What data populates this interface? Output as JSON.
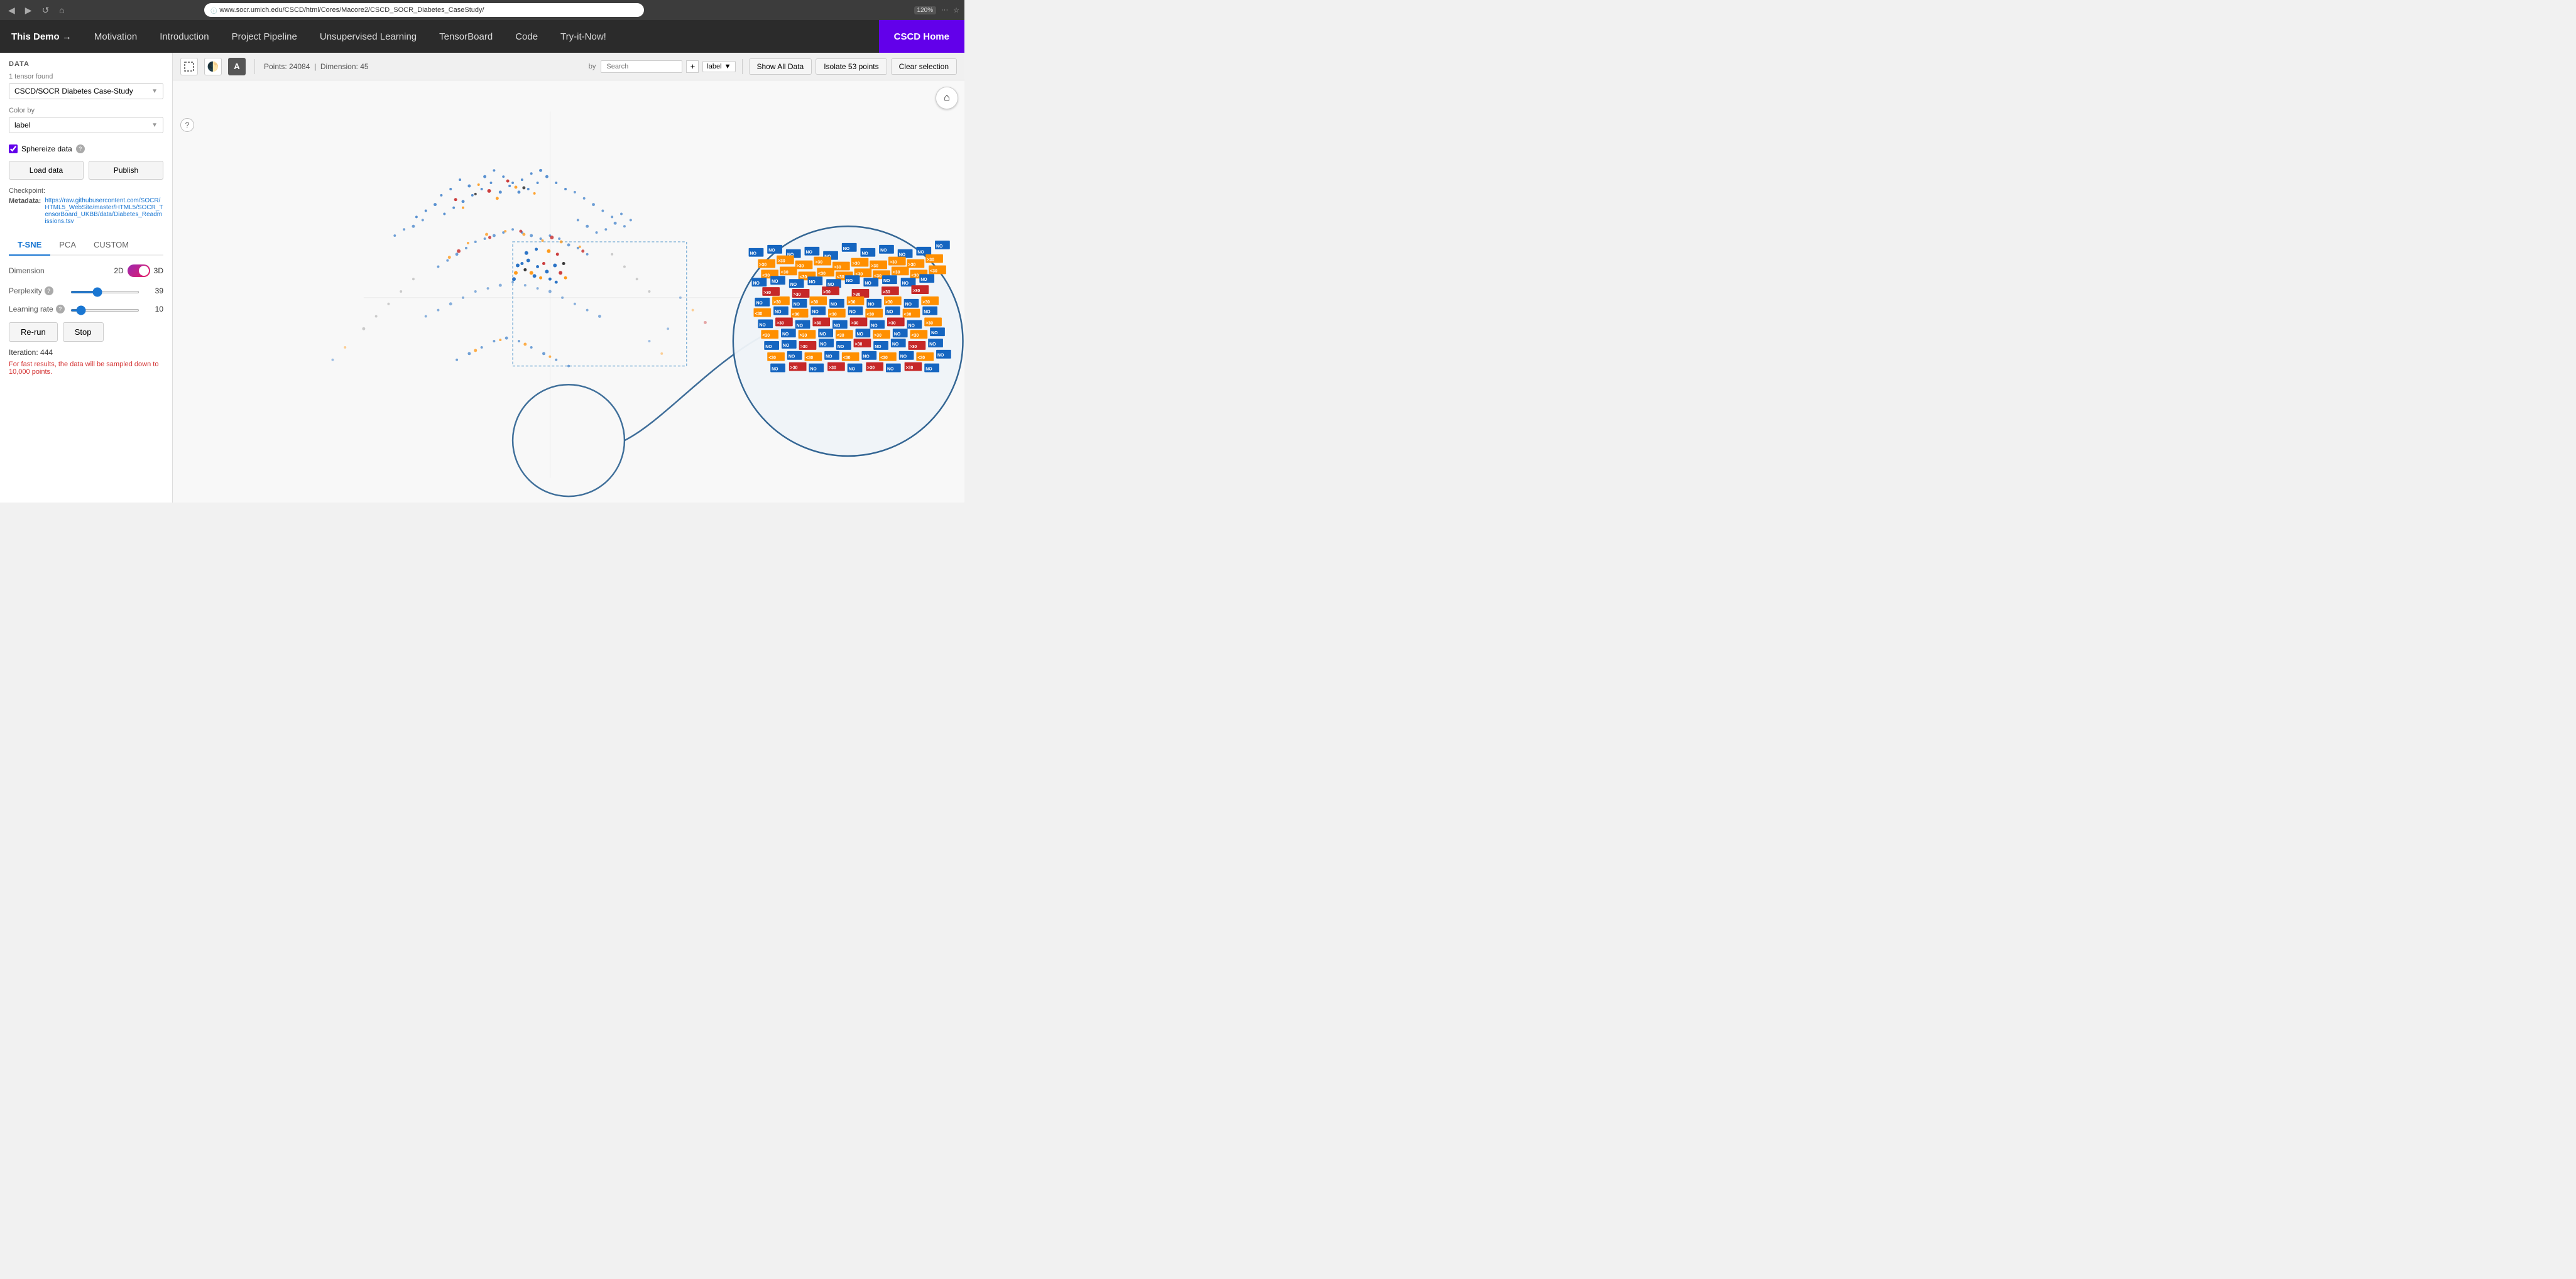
{
  "browser": {
    "url": "www.socr.umich.edu/CSCD/html/Cores/Macore2/CSCD_SOCR_Diabetes_CaseStudy/",
    "zoom": "120%",
    "back_btn": "◀",
    "forward_btn": "▶",
    "refresh_btn": "↺",
    "home_btn": "⌂"
  },
  "nav": {
    "this_demo": "This Demo →",
    "motivation": "Motivation",
    "introduction": "Introduction",
    "project_pipeline": "Project Pipeline",
    "unsupervised_learning": "Unsupervised Learning",
    "tensorboard": "TensorBoard",
    "code": "Code",
    "try_it_now": "Try-it-Now!",
    "cscd_home": "CSCD Home"
  },
  "sidebar": {
    "section_title": "DATA",
    "tensor_found": "1 tensor found",
    "dataset_name": "CSCD/SOCR Diabetes Case-Study",
    "color_by_label": "Color by",
    "color_by_value": "label",
    "sphereize_label": "Sphereize data",
    "load_btn": "Load data",
    "publish_btn": "Publish",
    "checkpoint_label": "Checkpoint:",
    "metadata_label": "Metadata:",
    "metadata_url": "https://raw.githubusercontent.com/SOCR/HTML5_WebSite/master/HTML5/SOCR_TensorBoard_UKBB/data/Diabetes_Readmissions.tsv",
    "method_tabs": [
      "T-SNE",
      "PCA",
      "CUSTOM"
    ],
    "active_tab": "T-SNE",
    "dimension_label": "Dimension",
    "dimension_2d": "2D",
    "dimension_3d": "3D",
    "perplexity_label": "Perplexity",
    "perplexity_value": 39,
    "learning_rate_label": "Learning rate",
    "learning_rate_value": 10,
    "rerun_btn": "Re-run",
    "stop_btn": "Stop",
    "iteration_label": "Iteration: 444",
    "warning_text": "For fast results, the data will be sampled down to 10,000 points."
  },
  "toolbar": {
    "points_info": "Points: 24084",
    "dimension_info": "Dimension: 45",
    "show_all_btn": "Show All Data",
    "isolate_btn": "Isolate 53 points",
    "clear_btn": "Clear selection",
    "search_placeholder": "Search",
    "search_by": "label",
    "search_by_label": "by"
  },
  "viz": {
    "help_tooltip": "?",
    "home_icon": "⌂"
  },
  "colors": {
    "accent": "#6200ea",
    "nav_bg": "#2b2b2b",
    "primary": "#1976d2",
    "danger": "#d32f2f",
    "dot_blue": "#1565c0",
    "dot_orange": "#ff8f00",
    "dot_red": "#c62828",
    "dot_dark": "#212121",
    "dot_gray": "#9e9e9e"
  }
}
